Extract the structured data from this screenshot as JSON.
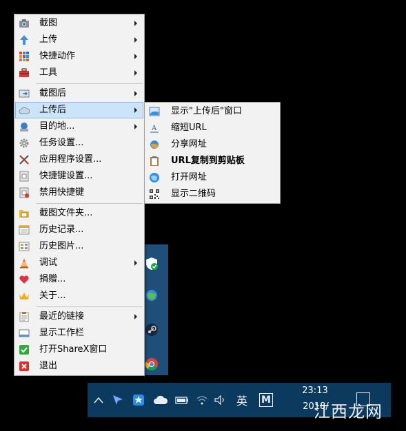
{
  "colors": {
    "menu_bg": "#f2f2f2",
    "highlight": "#cce4f7",
    "taskbar": "#0c3a5e"
  },
  "main_menu": {
    "items": [
      {
        "label": "截图",
        "icon": "camera-icon",
        "has_submenu": true
      },
      {
        "label": "上传",
        "icon": "upload-arrow-icon",
        "has_submenu": true
      },
      {
        "label": "快捷动作",
        "icon": "grid-icon",
        "has_submenu": true
      },
      {
        "label": "工具",
        "icon": "toolbox-icon",
        "has_submenu": true
      },
      {
        "label": "截图后",
        "icon": "after-capture-icon",
        "has_submenu": true
      },
      {
        "label": "上传后",
        "icon": "cloud-icon",
        "has_submenu": true
      },
      {
        "label": "目的地...",
        "icon": "destination-icon",
        "has_submenu": true
      },
      {
        "label": "任务设置...",
        "icon": "gear-icon",
        "has_submenu": false
      },
      {
        "label": "应用程序设置...",
        "icon": "wrench-screwdriver-icon",
        "has_submenu": false
      },
      {
        "label": "快捷键设置...",
        "icon": "keyboard-icon",
        "has_submenu": false
      },
      {
        "label": "禁用快捷键",
        "icon": "keyboard-disable-icon",
        "has_submenu": false
      },
      {
        "label": "截图文件夹...",
        "icon": "folder-icon",
        "has_submenu": false
      },
      {
        "label": "历史记录...",
        "icon": "history-icon",
        "has_submenu": false
      },
      {
        "label": "历史图片...",
        "icon": "image-history-icon",
        "has_submenu": false
      },
      {
        "label": "调试",
        "icon": "traffic-cone-icon",
        "has_submenu": true
      },
      {
        "label": "捐赠...",
        "icon": "heart-icon",
        "has_submenu": false
      },
      {
        "label": "关于...",
        "icon": "crown-icon",
        "has_submenu": false
      },
      {
        "label": "最近的链接",
        "icon": "clipboard-list-icon",
        "has_submenu": true
      },
      {
        "label": "显示工作栏",
        "icon": "taskbar-window-icon",
        "has_submenu": false
      },
      {
        "label": "打开ShareX窗口",
        "icon": "check-icon",
        "has_submenu": false
      },
      {
        "label": "退出",
        "icon": "close-icon",
        "has_submenu": false
      }
    ]
  },
  "sub_menu": {
    "items": [
      {
        "label": "显示\"上传后\"窗口",
        "icon": "window-icon",
        "bold": false
      },
      {
        "label": "缩短URL",
        "icon": "text-a-icon",
        "bold": false
      },
      {
        "label": "分享网址",
        "icon": "share-globe-icon",
        "bold": false
      },
      {
        "label": "URL复制到剪贴板",
        "icon": "clipboard-icon",
        "bold": true
      },
      {
        "label": "打开网址",
        "icon": "globe-icon",
        "bold": false
      },
      {
        "label": "显示二维码",
        "icon": "qr-code-icon",
        "bold": false
      }
    ]
  },
  "taskbar": {
    "time": "23:13",
    "date": "2018/",
    "ime": "英",
    "ime_mode": "M"
  },
  "watermark": "江西龙网"
}
